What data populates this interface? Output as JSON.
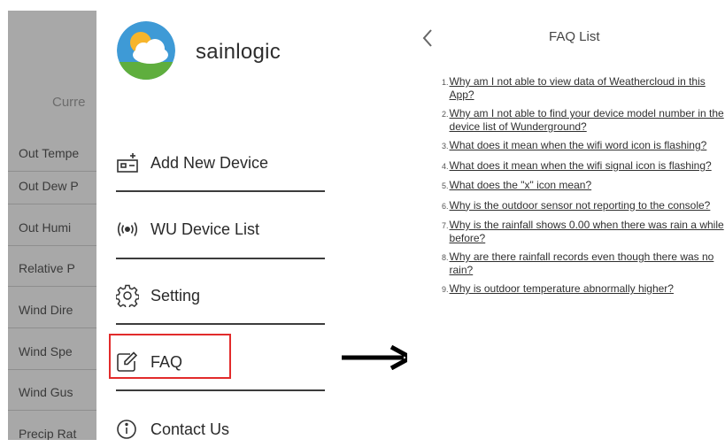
{
  "background_screen": {
    "title": "Curre",
    "rows": [
      "Out Tempe",
      "Out Dew P",
      "Out Humi",
      "Relative P",
      "Wind Dire",
      "Wind Spe",
      "Wind Gus",
      "Precip Rat"
    ]
  },
  "drawer": {
    "brand": "sainlogic",
    "menu": [
      {
        "label": "Add New Device",
        "icon": "add-device-icon"
      },
      {
        "label": "WU Device List",
        "icon": "signal-icon"
      },
      {
        "label": "Setting",
        "icon": "gear-icon"
      },
      {
        "label": "FAQ",
        "icon": "edit-icon"
      },
      {
        "label": "Contact Us",
        "icon": "info-icon"
      }
    ]
  },
  "faq": {
    "title": "FAQ List",
    "items": [
      {
        "num": "1.",
        "text": "Why am I not able to view data of Weathercloud in this App?"
      },
      {
        "num": "2.",
        "text": "Why am I not able to find your device model number in the device list of Wunderground?"
      },
      {
        "num": "3.",
        "text": "What does it mean when the wifi word icon is flashing?"
      },
      {
        "num": "4.",
        "text": "What does it mean when the wifi signal icon is flashing?"
      },
      {
        "num": "5.",
        "text": "What does the \"x\" icon mean?"
      },
      {
        "num": "6.",
        "text": "Why is the outdoor sensor not reporting to the console?"
      },
      {
        "num": "7.",
        "text": "Why is the rainfall shows 0.00 when there was rain a while before?"
      },
      {
        "num": "8.",
        "text": "Why are there rainfall records even though there was no rain?"
      },
      {
        "num": "9.",
        "text": "Why is outdoor temperature abnormally higher?"
      }
    ]
  },
  "colors": {
    "highlight": "#e22b2b",
    "dim_overlay": "#a8a8a8"
  }
}
